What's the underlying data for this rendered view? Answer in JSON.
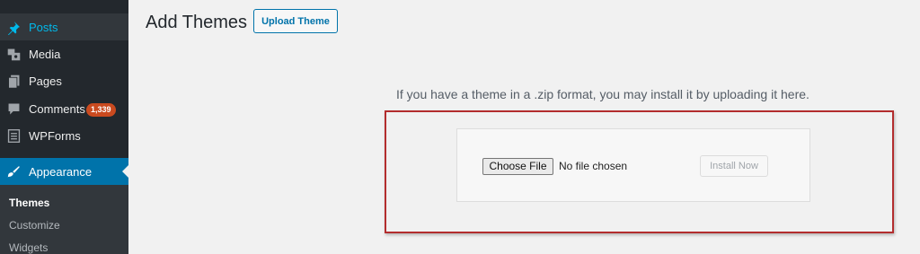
{
  "sidebar": {
    "items": [
      {
        "label": "Posts",
        "icon": "pin-icon"
      },
      {
        "label": "Media",
        "icon": "media-icon"
      },
      {
        "label": "Pages",
        "icon": "pages-icon"
      },
      {
        "label": "Comments",
        "icon": "comment-icon",
        "badge": "1,339"
      },
      {
        "label": "WPForms",
        "icon": "form-icon"
      },
      {
        "label": "Appearance",
        "icon": "brush-icon"
      }
    ],
    "submenu": [
      {
        "label": "Themes"
      },
      {
        "label": "Customize"
      },
      {
        "label": "Widgets"
      }
    ]
  },
  "header": {
    "title": "Add Themes",
    "upload_label": "Upload Theme"
  },
  "main": {
    "help_text": "If you have a theme in a .zip format, you may install it by uploading it here.",
    "choose_file_label": "Choose File",
    "file_status": "No file chosen",
    "install_label": "Install Now"
  },
  "colors": {
    "sidebar_bg": "#23282d",
    "active_menu_bg": "#0073aa",
    "badge_bg": "#ca4a1f",
    "highlight_border": "#b32d2e",
    "link_blue": "#0073aa"
  }
}
